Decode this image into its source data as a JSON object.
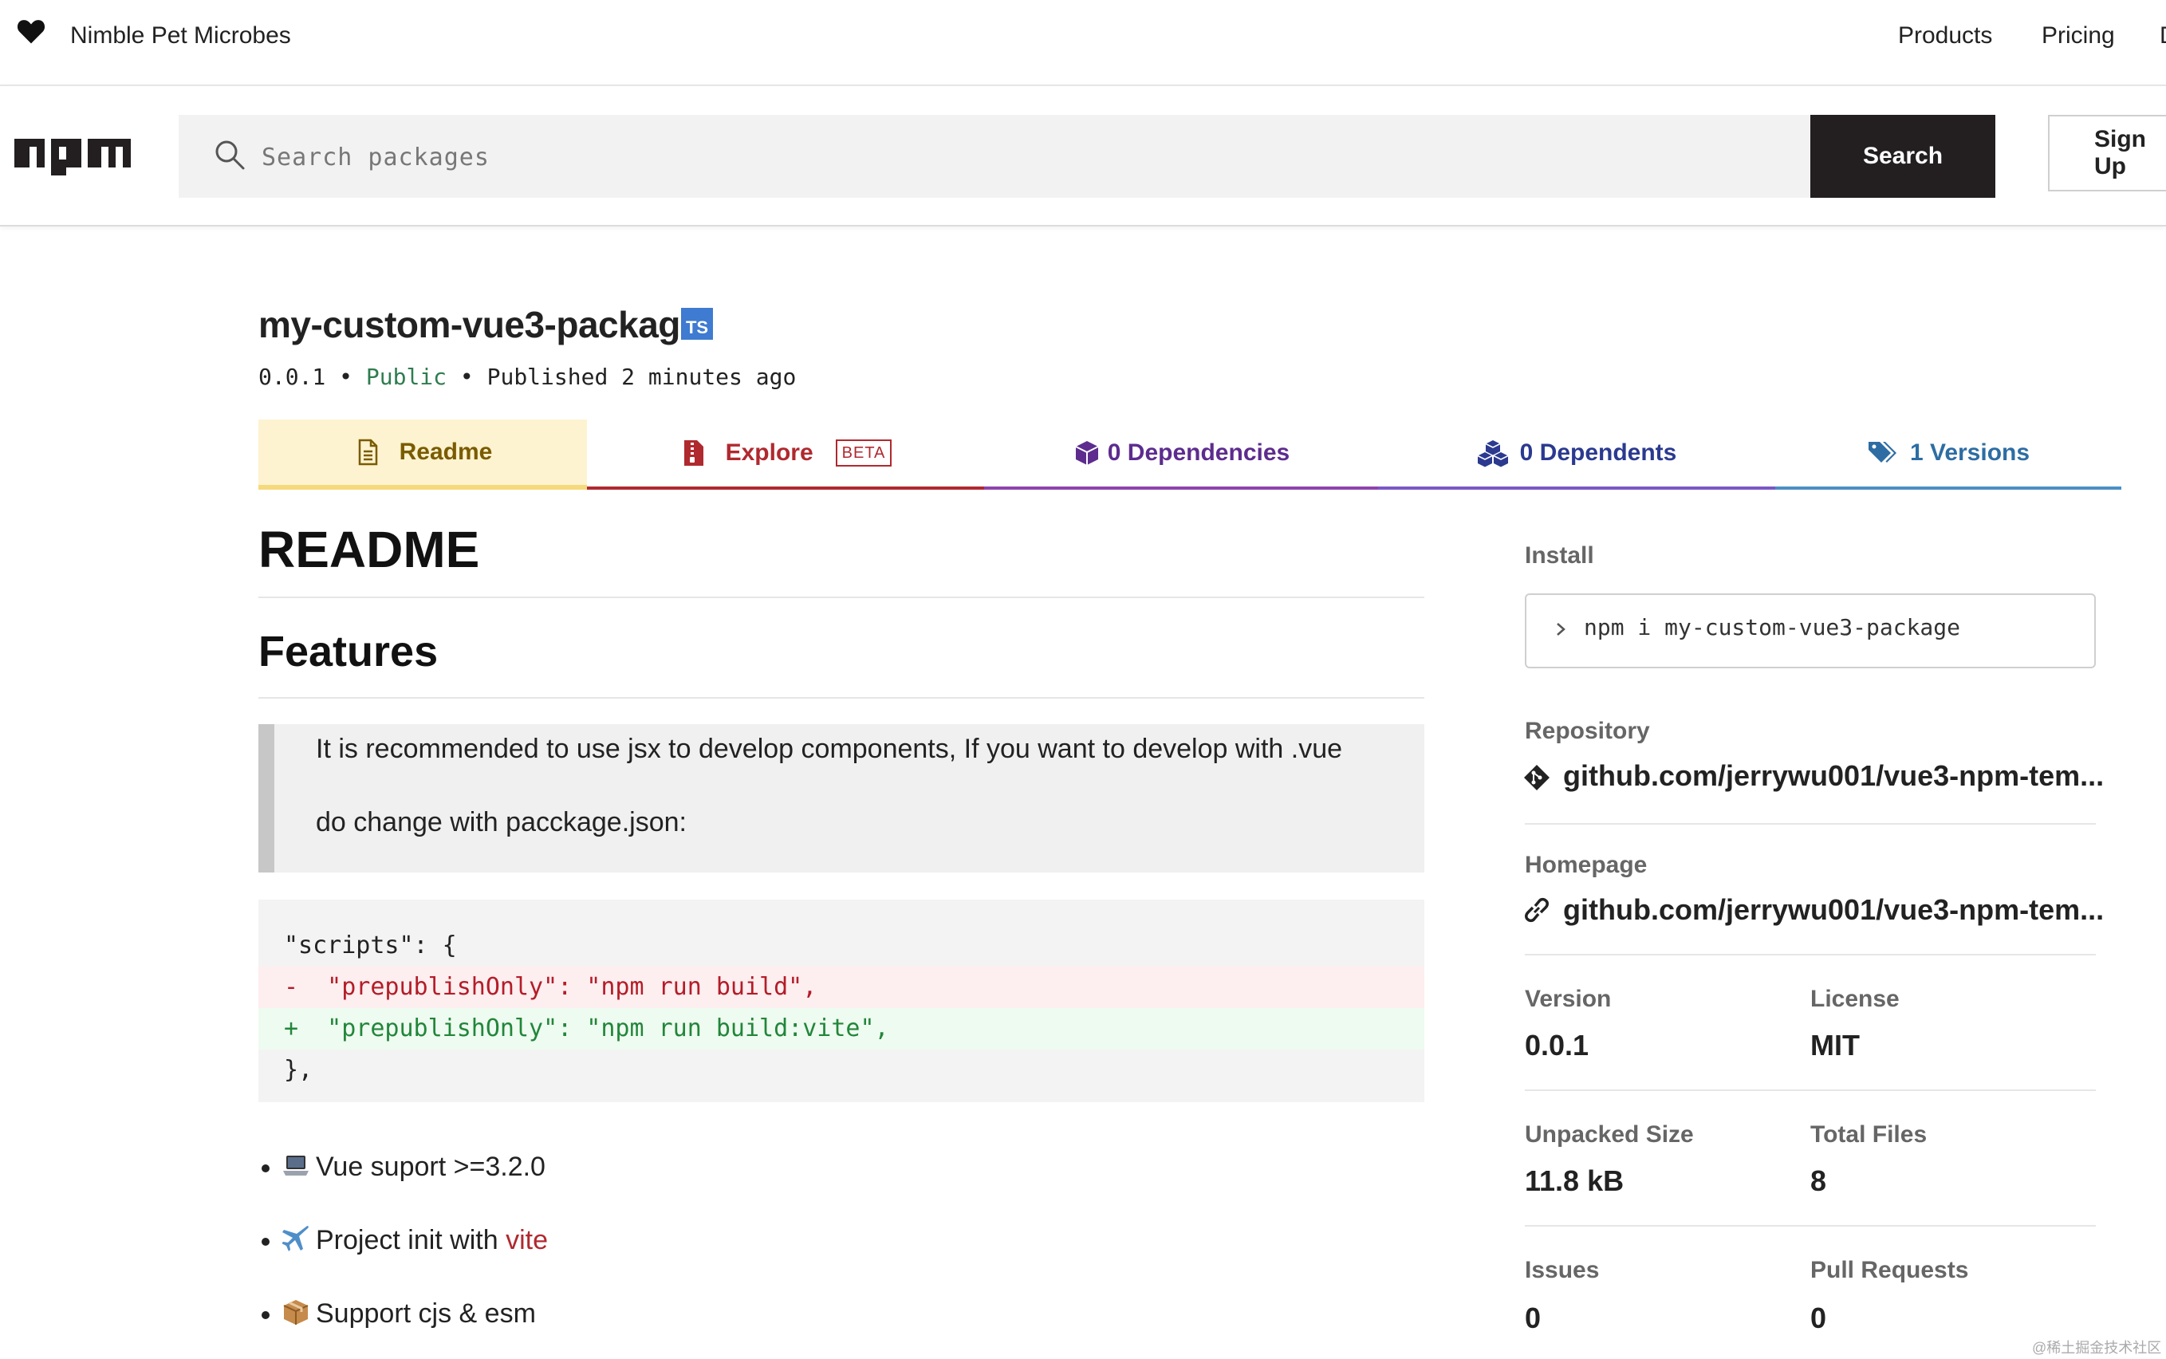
{
  "topbar": {
    "brand": "Nimble Pet Microbes",
    "nav": [
      "Products",
      "Pricing",
      "Documentation"
    ]
  },
  "search": {
    "placeholder": "Search packages",
    "button": "Search",
    "signup": "Sign Up"
  },
  "package": {
    "name": "my-custom-vue3-package",
    "ts_badge": "TS",
    "version": "0.0.1",
    "sep1": "•",
    "visibility": "Public",
    "sep2": "•",
    "published": "Published 2 minutes ago"
  },
  "tabs": {
    "readme": "Readme",
    "explore": "Explore",
    "beta": "BETA",
    "dependencies": "0 Dependencies",
    "dependents": "0 Dependents",
    "versions": "1 Versions"
  },
  "readme": {
    "title": "README",
    "features_heading": "Features",
    "quote_line1": "It is recommended to use jsx to develop components, If you want to develop with .vue",
    "quote_line2": "do change with pacckage.json:",
    "code": [
      "\"scripts\": {",
      "-  \"prepublishOnly\": \"npm run build\",",
      "+  \"prepublishOnly\": \"npm run build:vite\",",
      "},"
    ],
    "features": [
      {
        "icon": "laptop-emoji",
        "text": "Vue suport >=3.2.0"
      },
      {
        "icon": "airplane-emoji",
        "text": "Project init with ",
        "link": "vite"
      },
      {
        "icon": "package-emoji",
        "text": "Support cjs & esm"
      }
    ]
  },
  "sidebar": {
    "install_label": "Install",
    "install_cmd": "npm i my-custom-vue3-package",
    "repository_label": "Repository",
    "repository": "github.com/jerrywu001/vue3-npm-tem...",
    "homepage_label": "Homepage",
    "homepage": "github.com/jerrywu001/vue3-npm-tem...",
    "version_label": "Version",
    "version": "0.0.1",
    "license_label": "License",
    "license": "MIT",
    "unpacked_label": "Unpacked Size",
    "unpacked": "11.8 kB",
    "files_label": "Total Files",
    "files": "8",
    "issues_label": "Issues",
    "issues": "0",
    "prs_label": "Pull Requests",
    "prs": "0"
  },
  "watermark": "@稀土掘金技术社区",
  "colors": {
    "npm_dark": "#231f20",
    "readme_tab": "#fdf3d0",
    "explore_red": "#b0292f",
    "deps_purple": "#8e44ad",
    "versions_blue": "#4b8fc4",
    "public_green": "#2e7d4f",
    "ts_blue": "#3e7bd1"
  }
}
